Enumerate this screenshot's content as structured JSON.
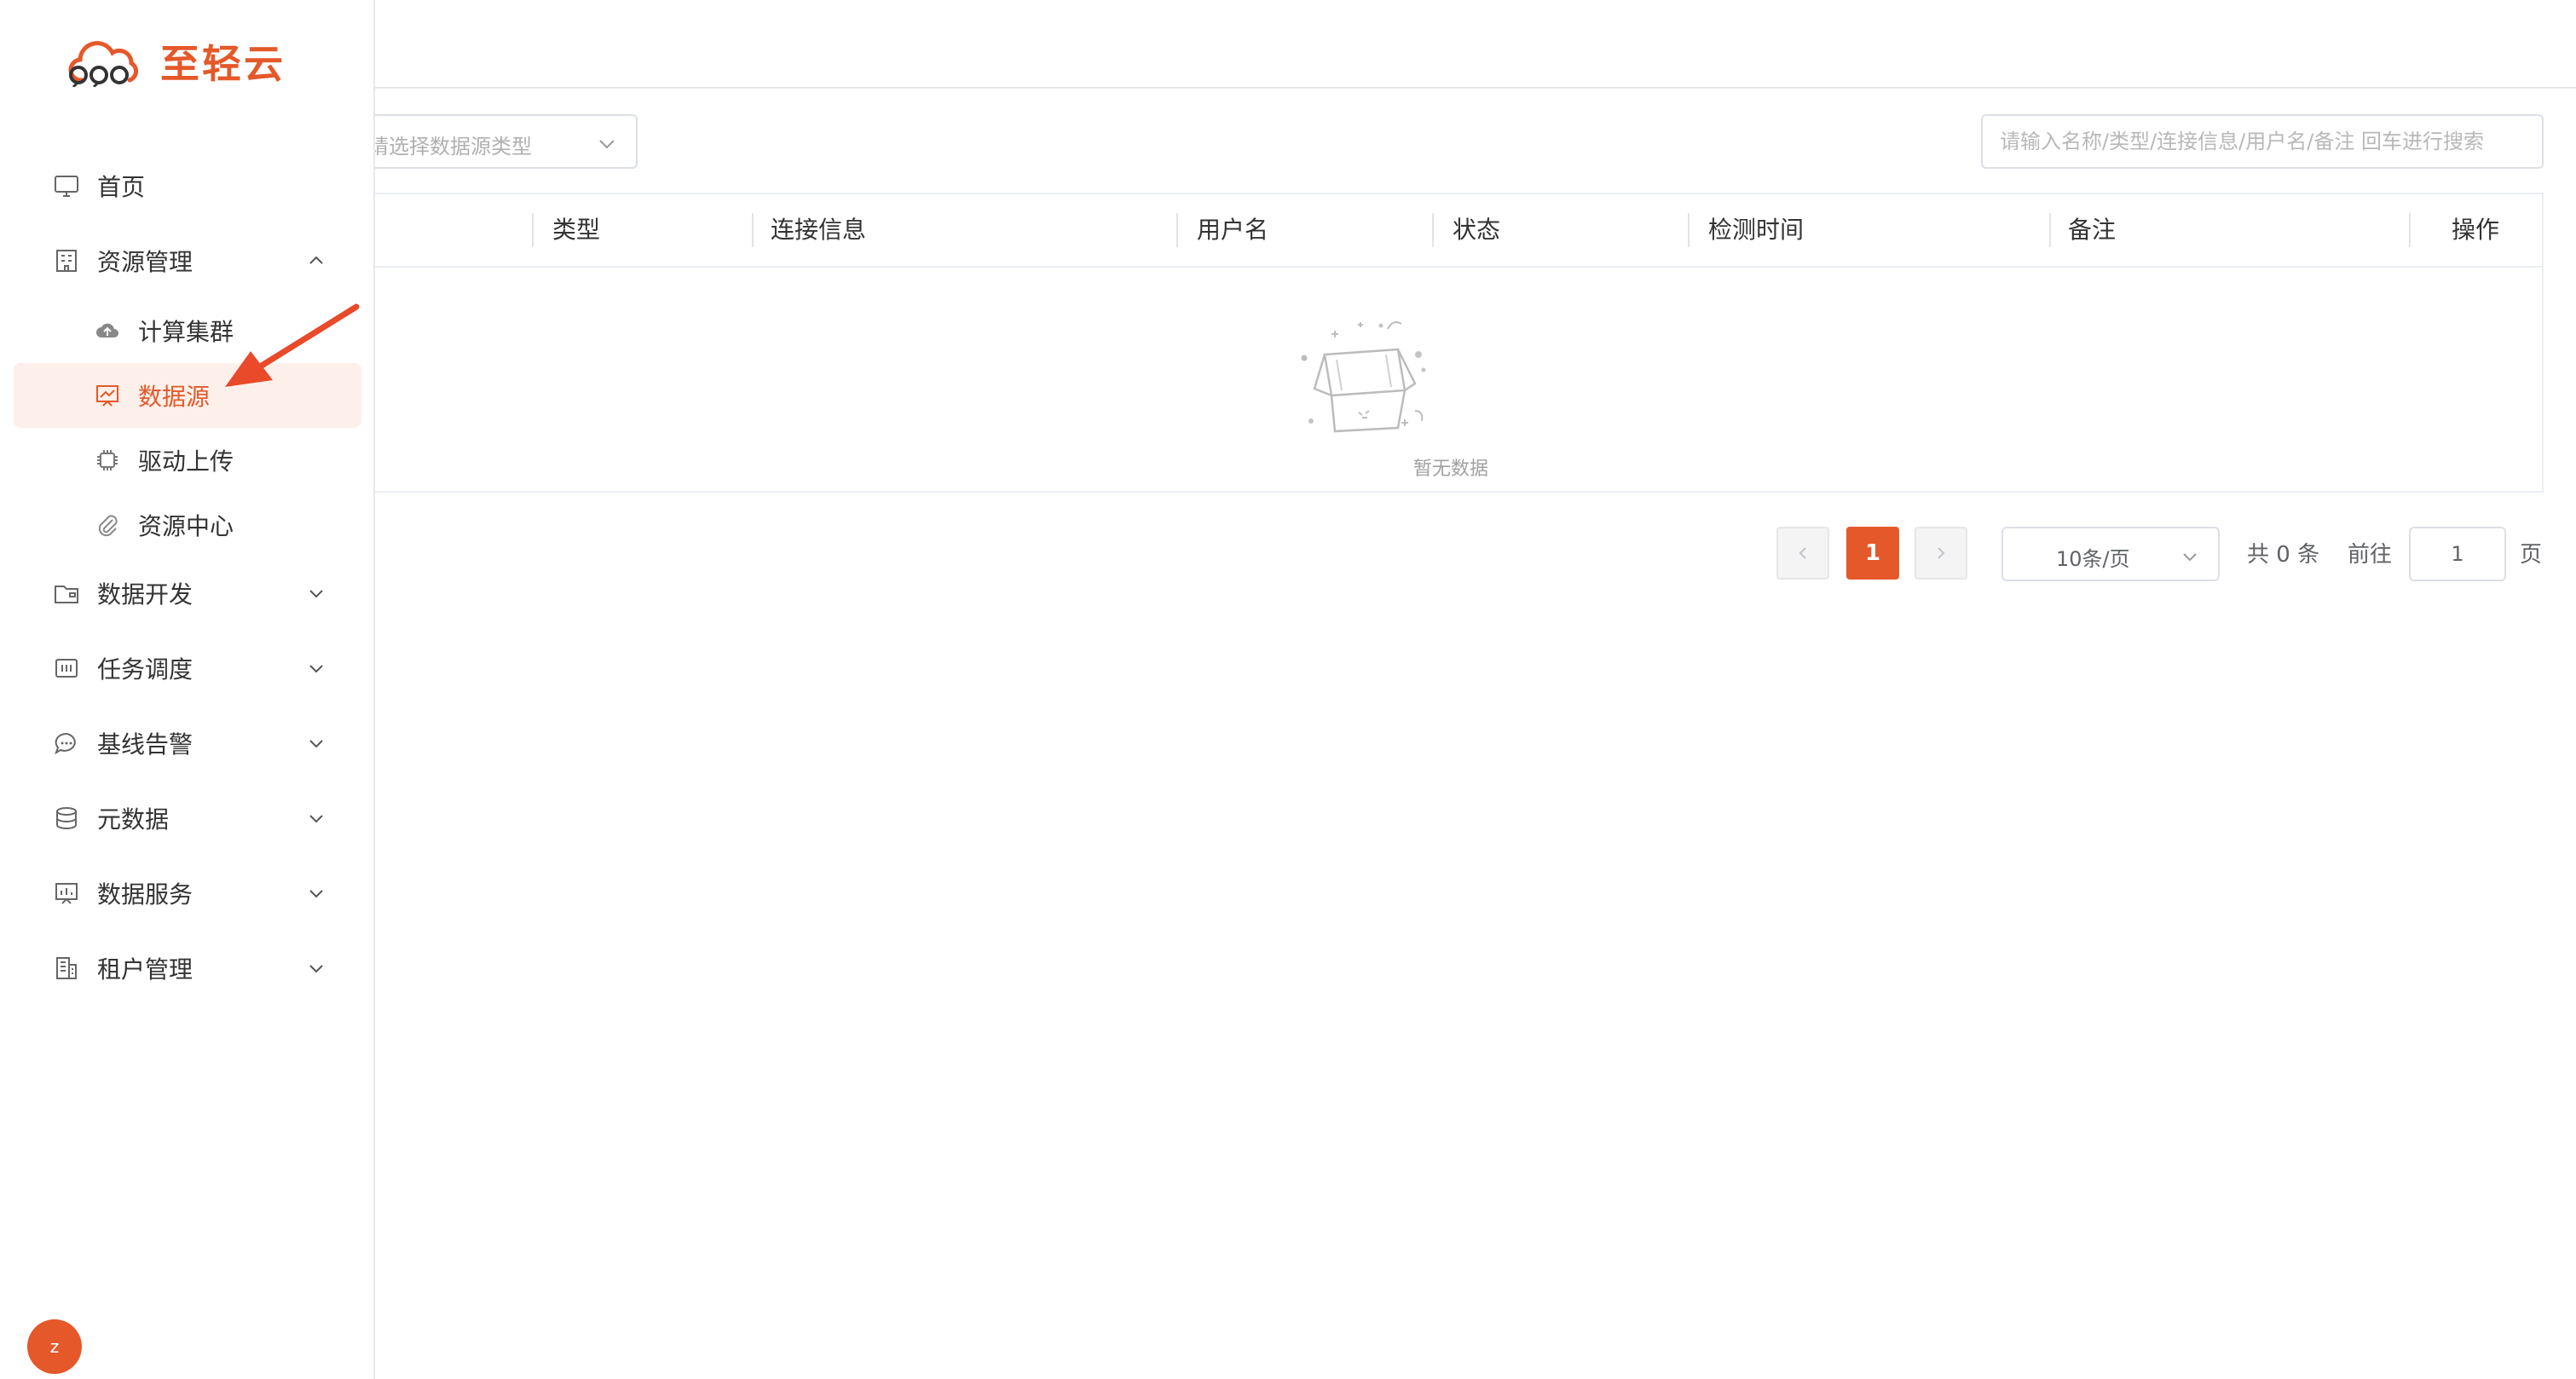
{
  "brand": {
    "name": "至轻云",
    "color": "#e5582a"
  },
  "sidebar": {
    "items": [
      {
        "label": "首页",
        "icon": "monitor-icon"
      },
      {
        "label": "资源管理",
        "icon": "building-icon",
        "expanded": true,
        "children": [
          {
            "label": "计算集群",
            "icon": "cloud-upload-icon"
          },
          {
            "label": "数据源",
            "icon": "presentation-chart-icon",
            "active": true
          },
          {
            "label": "驱动上传",
            "icon": "chip-icon"
          },
          {
            "label": "资源中心",
            "icon": "paperclip-icon"
          }
        ]
      },
      {
        "label": "数据开发",
        "icon": "folder-icon"
      },
      {
        "label": "任务调度",
        "icon": "schedule-icon"
      },
      {
        "label": "基线告警",
        "icon": "chat-bubble-icon"
      },
      {
        "label": "元数据",
        "icon": "database-icon"
      },
      {
        "label": "数据服务",
        "icon": "service-board-icon"
      },
      {
        "label": "租户管理",
        "icon": "office-building-icon"
      }
    ]
  },
  "user": {
    "avatar_letter": "z"
  },
  "filters": {
    "type_placeholder": "请选择数据源类型",
    "search_placeholder": "请输入名称/类型/连接信息/用户名/备注 回车进行搜索"
  },
  "table": {
    "columns": [
      "类型",
      "连接信息",
      "用户名",
      "状态",
      "检测时间",
      "备注",
      "操作"
    ],
    "rows": [],
    "empty_text": "暂无数据"
  },
  "pagination": {
    "current_page": "1",
    "page_size_label": "10条/页",
    "total_label": "共 0 条",
    "goto_label": "前往",
    "goto_value": "1",
    "page_suffix": "页"
  }
}
